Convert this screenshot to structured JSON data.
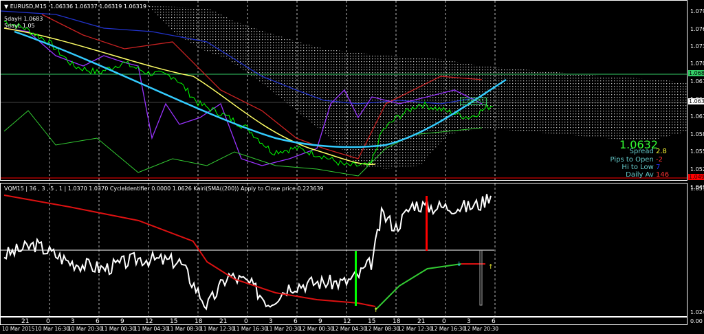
{
  "header": {
    "symbol": "EURUSD,M15",
    "ohlc": "1.06336 1.06337 1.06319 1.06319",
    "level_high": "5dayH 1.0683",
    "level_low": "5dayL 1.05"
  },
  "price_axis": [
    "1.07935",
    "1.07635",
    "1.07335",
    "1.07040",
    "1.06740",
    "1.06440",
    "1.06140",
    "1.05840",
    "1.05540",
    "1.05240",
    "1.04940"
  ],
  "price_tags": {
    "green_line": "1.06806",
    "current": "1.06319",
    "red_line": "1.04907"
  },
  "chart_label": "1.06351",
  "info_panel": {
    "price": "1.0632",
    "spread_label": "Spread",
    "spread": "2.8",
    "pips_label": "Pips to Open",
    "pips": "-2",
    "hilo_label": "Hi to Low",
    "hilo": "7",
    "daily_label": "Daily Av",
    "daily": "146"
  },
  "indicator": {
    "header": "VQM15 | 36 , 3 , 5 , 1 | 1.0370 1.0370 CycleIdentifier 0.0000 1.0626 Kairi(SMA((200)) Apply to Close price 0.223639",
    "axis": [
      "1.0572",
      "1.024",
      "0.00"
    ]
  },
  "time_axis": {
    "hours": [
      "21",
      "0",
      "3",
      "6",
      "9",
      "12",
      "15",
      "18",
      "21",
      "0",
      "3",
      "6",
      "9",
      "12",
      "15",
      "18",
      "21",
      "0",
      "3",
      "6"
    ],
    "dates": [
      "10 Mar 2015",
      "10 Mar 16:30",
      "10 Mar 20:30",
      "11 Mar 00:30",
      "11 Mar 04:30",
      "11 Mar 08:30",
      "11 Mar 12:30",
      "11 Mar 16:30",
      "11 Mar 20:30",
      "12 Mar 00:30",
      "12 Mar 04:30",
      "12 Mar 08:30",
      "12 Mar 12:30",
      "12 Mar 16:30",
      "12 Mar 20:30"
    ]
  },
  "colors": {
    "up": "#00ff00",
    "ma_yellow": "#ffff66",
    "ma_cyan": "#33ccff",
    "red": "#ff0000",
    "purple": "#9933ff",
    "green_line": "#33cc66"
  },
  "chart_data": {
    "type": "line",
    "x_unit": "hours since 10 Mar 21:00",
    "price": {
      "x": [
        -2.5,
        0,
        2.9,
        5.9,
        9,
        11.9,
        14.9,
        18.1,
        21.1,
        23.9,
        26.9,
        30,
        32.9,
        35.9,
        38.9,
        41.9,
        43.3,
        45.1,
        47.9,
        50.9,
        53.9,
        56.9
      ],
      "y": [
        1.07783,
        1.07665,
        1.07431,
        1.07021,
        1.06904,
        1.07079,
        1.06904,
        1.06845,
        1.06376,
        1.06201,
        1.05966,
        1.05556,
        1.05615,
        1.05497,
        1.05321,
        1.05321,
        1.05907,
        1.06142,
        1.06376,
        1.06259,
        1.06142,
        1.06376
      ],
      "ylim": [
        1.0494,
        1.0815
      ]
    },
    "indicator_white": {
      "x": [
        -2.5,
        1.3,
        5.4,
        9.6,
        13.8,
        18.8,
        22.1,
        24.6,
        27.1,
        29.6,
        32.1,
        35.4,
        38.8,
        40.4,
        42.1,
        43.3,
        45,
        47.1,
        48.8,
        51.3,
        53.8,
        55.4,
        56.7
      ],
      "y": [
        1.03942,
        1.04214,
        1.03761,
        1.03579,
        1.03852,
        1.03761,
        1.02582,
        1.03398,
        1.03217,
        1.02672,
        1.03126,
        1.03217,
        1.03217,
        1.03398,
        1.03761,
        1.05031,
        1.04668,
        1.05303,
        1.05212,
        1.05212,
        1.05212,
        1.05303,
        1.05611
      ]
    },
    "indicator_red": {
      "x": [
        -2.5,
        5.4,
        13.8,
        20.4,
        22.1,
        25.4,
        30.4,
        35.4,
        40.4,
        42.5
      ],
      "y": [
        1.0552,
        1.05212,
        1.04849,
        1.04305,
        1.03761,
        1.03307,
        1.02945,
        1.02763,
        1.02672,
        1.02582
      ]
    },
    "indicator_green": {
      "x": [
        42.5,
        45.4,
        48.8,
        52.9
      ],
      "y": [
        1.02491,
        1.03126,
        1.03579,
        1.03706
      ]
    },
    "indicator_level": 1.04069,
    "indicator_ylim": [
      1.0225,
      1.0589
    ]
  }
}
